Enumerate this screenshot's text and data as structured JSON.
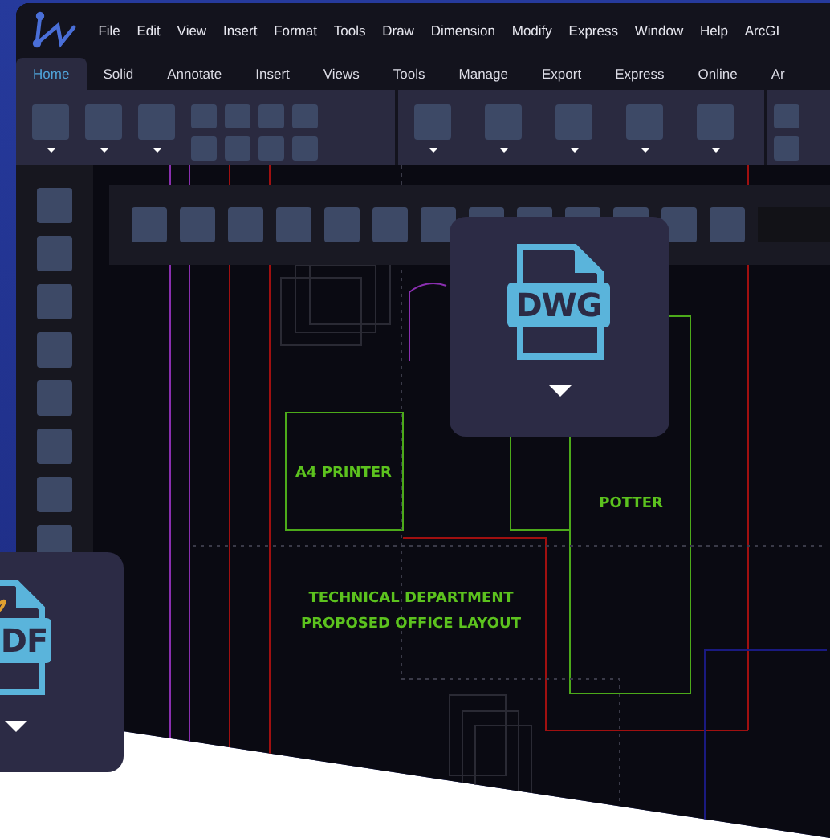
{
  "menu": [
    "File",
    "Edit",
    "View",
    "Insert",
    "Format",
    "Tools",
    "Draw",
    "Dimension",
    "Modify",
    "Express",
    "Window",
    "Help",
    "ArcGI"
  ],
  "tabs": [
    {
      "label": "Home",
      "selected": true
    },
    {
      "label": "Solid",
      "selected": false
    },
    {
      "label": "Annotate",
      "selected": false
    },
    {
      "label": "Insert",
      "selected": false
    },
    {
      "label": "Views",
      "selected": false
    },
    {
      "label": "Tools",
      "selected": false
    },
    {
      "label": "Manage",
      "selected": false
    },
    {
      "label": "Export",
      "selected": false
    },
    {
      "label": "Express",
      "selected": false
    },
    {
      "label": "Online",
      "selected": false
    },
    {
      "label": "Ar",
      "selected": false
    }
  ],
  "canvas_labels": [
    {
      "text": "A4 PRINTER"
    },
    {
      "text": "POTTER"
    },
    {
      "text": "TECHNICAL DEPARTMENT\nPROPOSED OFFICE LAYOUT"
    }
  ],
  "file_cards": [
    {
      "kind": "dwg",
      "type_label": "DWG"
    },
    {
      "kind": "pdf",
      "type_label": "DF"
    }
  ]
}
